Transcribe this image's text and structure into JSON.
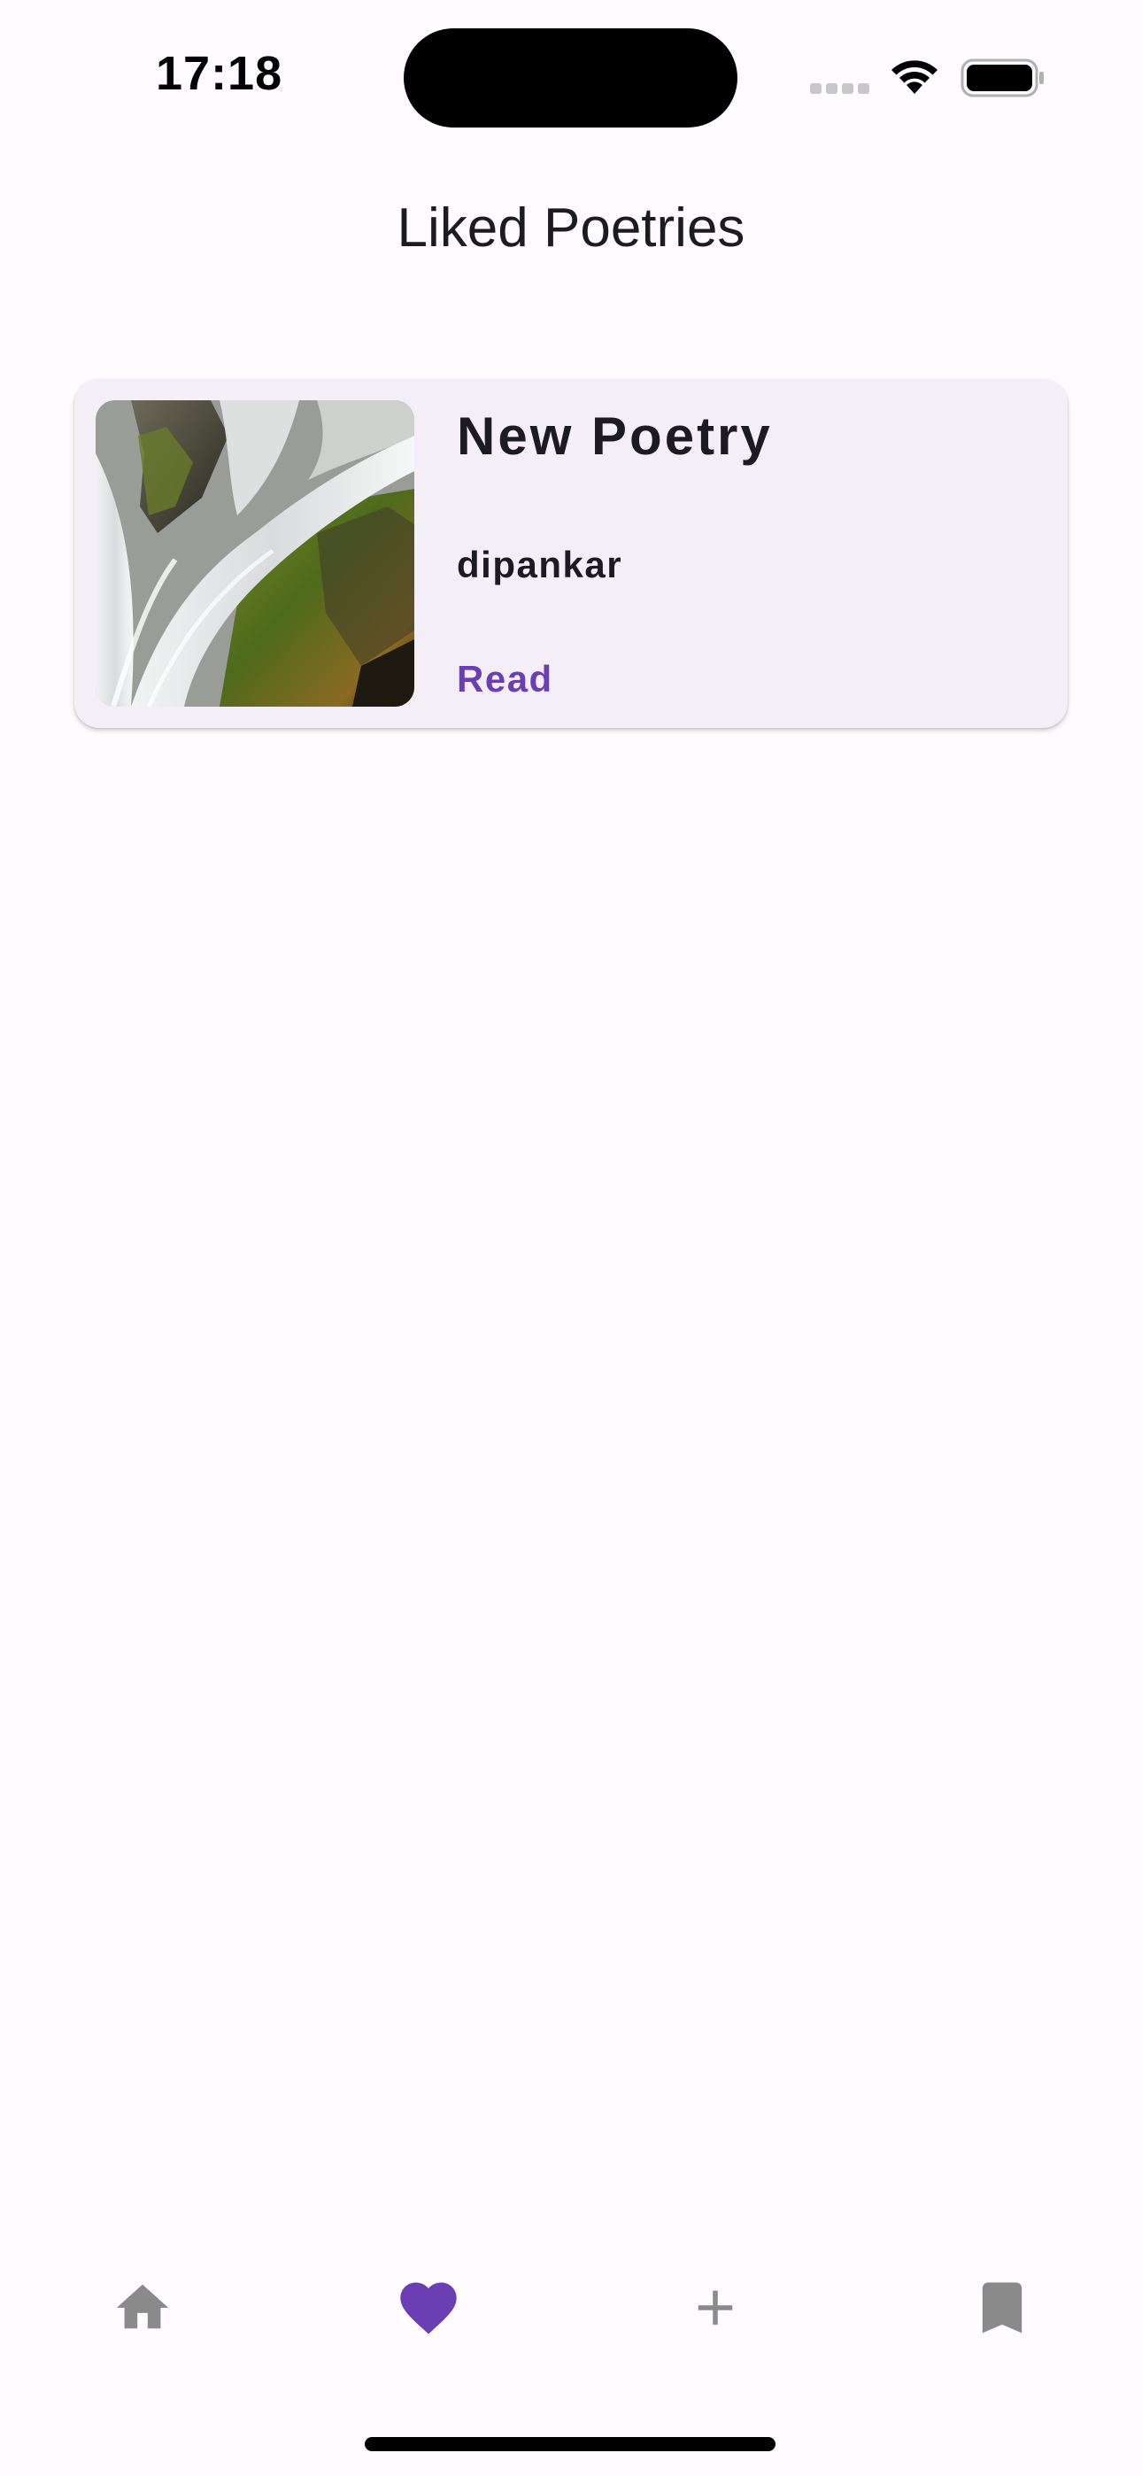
{
  "status_bar": {
    "time": "17:18"
  },
  "header": {
    "title": "Liked Poetries"
  },
  "liked_poetries": [
    {
      "title": "New Poetry",
      "author": "dipankar",
      "action_label": "Read",
      "thumbnail": "waterfall-photo"
    }
  ],
  "bottom_nav": {
    "items": [
      {
        "icon": "home-icon",
        "active": false
      },
      {
        "icon": "heart-icon",
        "active": true
      },
      {
        "icon": "plus-icon",
        "active": false
      },
      {
        "icon": "bookmark-icon",
        "active": false
      }
    ]
  },
  "colors": {
    "accent": "#6b3fb3",
    "card_background": "#f4eff7",
    "inactive_icon": "#8a8a8a",
    "background": "#fffbfe"
  }
}
